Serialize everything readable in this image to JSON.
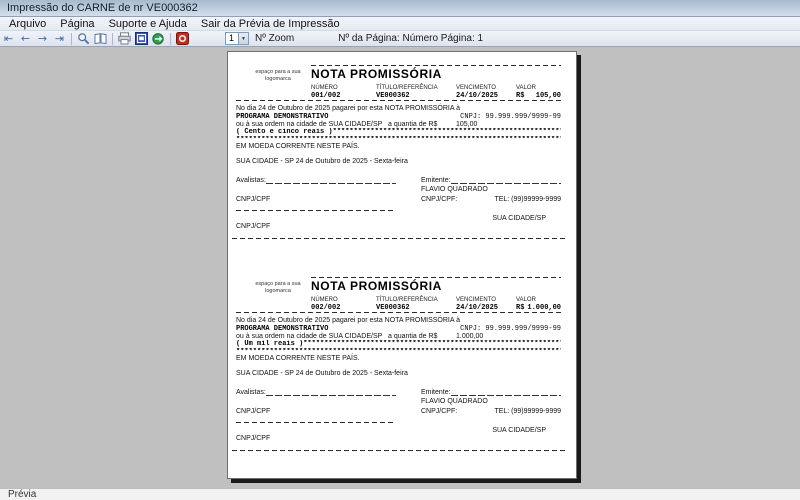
{
  "window": {
    "title": "Impressão do CARNE de nr VE000362"
  },
  "menu": {
    "items": [
      "Arquivo",
      "Página",
      "Suporte e Ajuda",
      "Sair da Prévia de Impressão"
    ]
  },
  "toolbar": {
    "nav": [
      {
        "name": "first-page",
        "glyph": "⇤"
      },
      {
        "name": "previous-page",
        "glyph": "←"
      },
      {
        "name": "next-page",
        "glyph": "→"
      },
      {
        "name": "last-page",
        "glyph": "⇥"
      }
    ],
    "zoom_value": "1",
    "zoom_label": "Nº Zoom",
    "page_info": "Nº da Página: Número Página: 1"
  },
  "note_labels": {
    "logo_hint": "espaço para a sua logomarca",
    "title": "NOTA PROMISSÓRIA",
    "col_numero": "NÚMERO",
    "col_titulo": "TÍTULO/REFERÊNCIA",
    "col_vencimento": "VENCIMENTO",
    "col_valor": "VALOR",
    "moeda_corrente": "EM MOEDA CORRENTE NESTE PAÍS.",
    "avalistas": "Avalistas:",
    "emitente": "Emitente:",
    "cnpjcpf": "CNPJ/CPF",
    "cnpjcpf_colon": "CNPJ/CPF:"
  },
  "notes": [
    {
      "numero": "001/002",
      "referencia": "VE000362",
      "vencimento": "24/10/2025",
      "moeda_simbolo": "R$",
      "valor": "105,00",
      "promessa": "No dia 24 de Outubro de 2025 pagarei por esta NOTA PROMISSÓRIA à",
      "beneficiario": "PROGRAMA DEMONSTRATIVO",
      "cnpj": "CNPJ: 99.999.999/9999-99",
      "ordem": "ou à sua ordem na cidade de SUA CIDADE/SP   a quantia de R$",
      "quantia": "105,00",
      "extenso": "( Cento e cinco reais )*************************************************************",
      "asteriscos": "*************************************************************************************",
      "cidade_data": "SUA CIDADE - SP 24 de Outubro de 2025 - Sexta-feira",
      "emitente_nome": "FLAVIO QUADRADO",
      "telefone": "TEL: (99)99999-9999",
      "cidade": "SUA CIDADE/SP"
    },
    {
      "numero": "002/002",
      "referencia": "VE000362",
      "vencimento": "24/10/2025",
      "moeda_simbolo": "R$",
      "valor": "1.000,00",
      "promessa": "No dia 24 de Outubro de 2025 pagarei por esta NOTA PROMISSÓRIA à",
      "beneficiario": "PROGRAMA DEMONSTRATIVO",
      "cnpj": "CNPJ: 99.999.999/9999-99",
      "ordem": "ou à sua ordem na cidade de SUA CIDADE/SP   a quantia de R$",
      "quantia": "1.000,00",
      "extenso": "( Um mil reais )********************************************************************",
      "asteriscos": "*************************************************************************************",
      "cidade_data": "SUA CIDADE - SP 24 de Outubro de 2025 - Sexta-feira",
      "emitente_nome": "FLAVIO QUADRADO",
      "telefone": "TEL: (99)99999-9999",
      "cidade": "SUA CIDADE/SP"
    }
  ],
  "statusbar": {
    "text": "Prévia"
  }
}
